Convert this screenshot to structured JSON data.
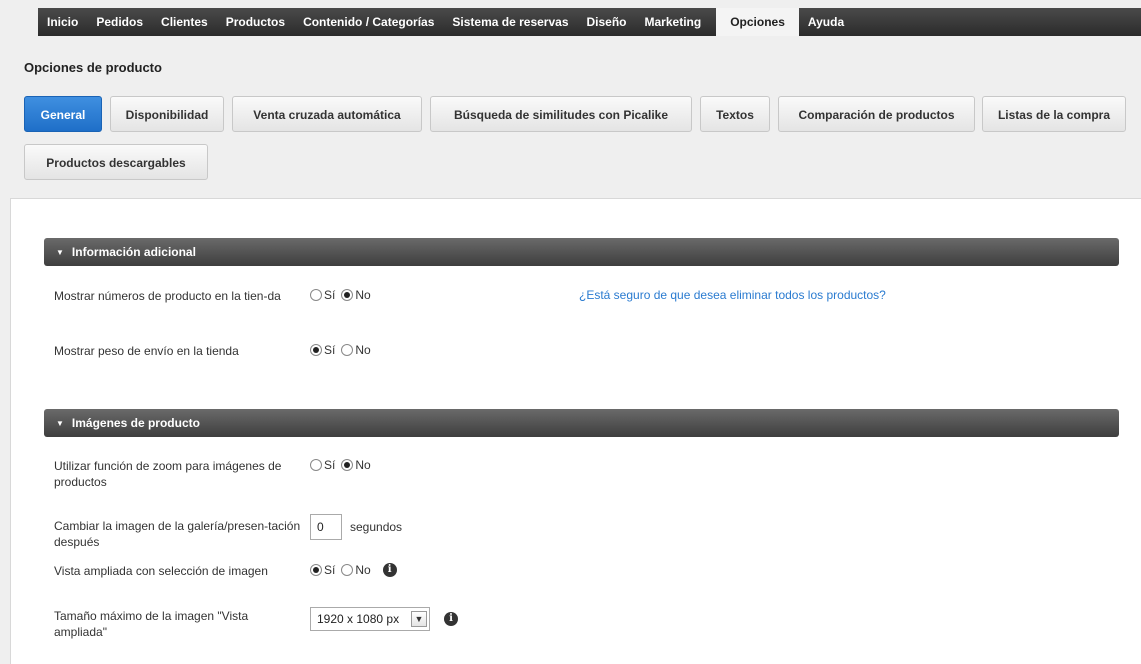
{
  "nav": {
    "items": [
      "Inicio",
      "Pedidos",
      "Clientes",
      "Productos",
      "Contenido / Categorías",
      "Sistema de reservas",
      "Diseño",
      "Marketing",
      "Opciones",
      "Ayuda"
    ],
    "active": "Opciones"
  },
  "page": {
    "title": "Opciones de producto"
  },
  "tabs": [
    "General",
    "Disponibilidad",
    "Venta cruzada automática",
    "Búsqueda de similitudes con Picalike",
    "Textos",
    "Comparación de productos",
    "Listas de la compra",
    "Productos descargables"
  ],
  "active_tab": "General",
  "sections": {
    "info": {
      "title": "Información adicional"
    },
    "images": {
      "title": "Imágenes de producto"
    }
  },
  "options": {
    "show_numbers": {
      "label": "Mostrar números de producto en la tien-da",
      "selected": "No"
    },
    "delete_link": "¿Está seguro de que desea eliminar todos los productos?",
    "show_weight": {
      "label": "Mostrar peso de envío en la tienda",
      "selected": "Sí"
    },
    "zoom": {
      "label": "Utilizar función de zoom para imágenes de productos",
      "selected": "No"
    },
    "gallery": {
      "label": "Cambiar la imagen de la galería/presen-tación después",
      "value": "0",
      "unit": "segundos"
    },
    "enlarged": {
      "label": "Vista ampliada con selección de imagen",
      "selected": "Sí"
    },
    "max_size": {
      "label": "Tamaño máximo de la imagen \"Vista ampliada\"",
      "value": "1920 x 1080 px"
    }
  },
  "radio_labels": {
    "yes": "Sí",
    "no": "No"
  },
  "icons": {
    "caret": "caret-down-icon",
    "info": "info-icon",
    "dropdown": "chevron-down-icon"
  }
}
